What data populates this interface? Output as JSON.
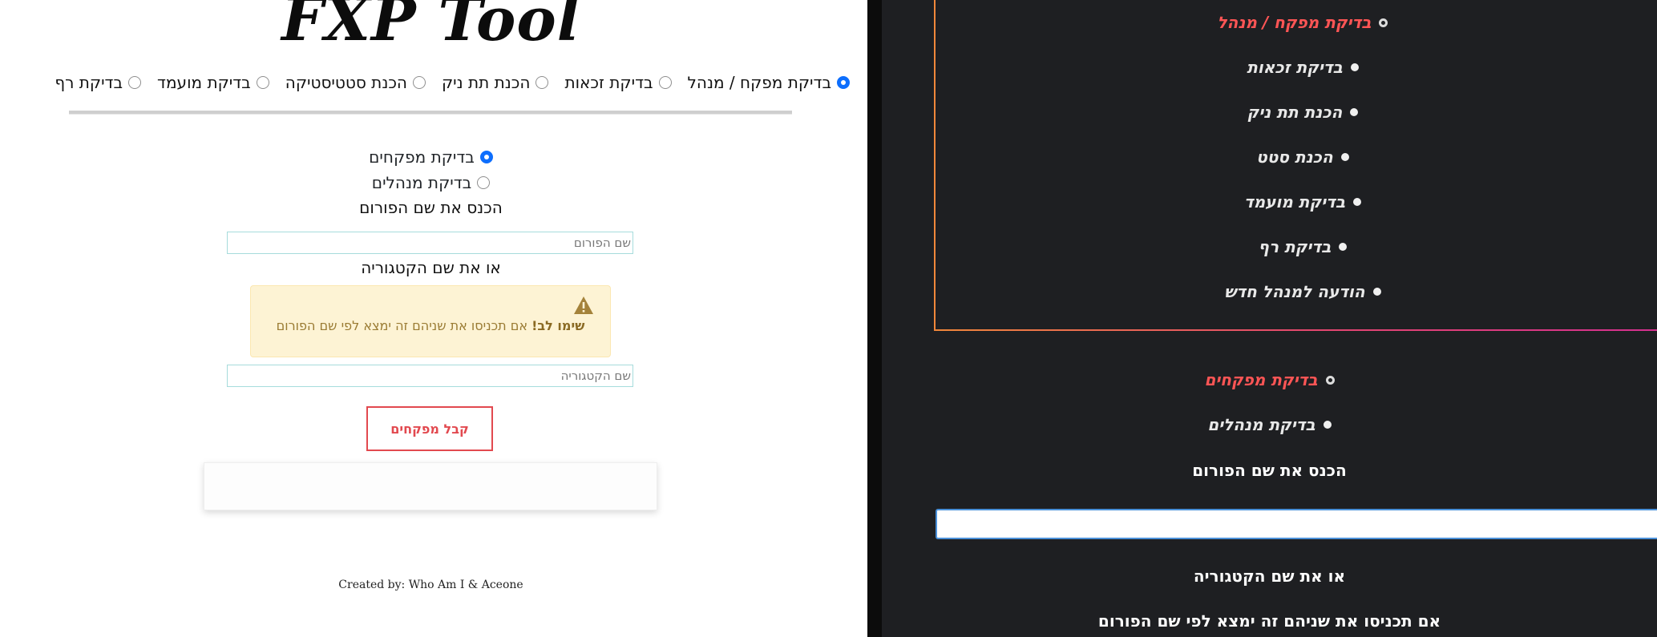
{
  "left": {
    "logo": "FXP Tool",
    "tool_options": [
      {
        "label": "בדיקת מפקח / מנהל",
        "selected": true
      },
      {
        "label": "בדיקת זכאות",
        "selected": false
      },
      {
        "label": "הכנת תת ניק",
        "selected": false
      },
      {
        "label": "הכנת סטטיסטיקה",
        "selected": false
      },
      {
        "label": "בדיקת מועמד",
        "selected": false
      },
      {
        "label": "בדיקת רף",
        "selected": false
      }
    ],
    "check_options": [
      {
        "label": "בדיקת מפקחים",
        "selected": true
      },
      {
        "label": "בדיקת מנהלים",
        "selected": false
      }
    ],
    "forum_label": "הכנס את שם הפורום",
    "forum_placeholder": "שם הפורום",
    "category_label": "או את שם הקטגוריה",
    "alert_bold": "שימו לב!",
    "alert_text": " אם תכניסו את שניהם זה ימצא לפי שם הפורום",
    "category_placeholder": "שם הקטגוריה",
    "submit_label": "קבל מפקחים",
    "credit": "Created by: Who Am I & Aceone"
  },
  "right": {
    "nav_items": [
      {
        "label": "בדיקת מפקח / מנהל",
        "active": true
      },
      {
        "label": "בדיקת זכאות",
        "active": false
      },
      {
        "label": "הכנת תת ניק",
        "active": false
      },
      {
        "label": "הכנת סטט",
        "active": false
      },
      {
        "label": "בדיקת מועמד",
        "active": false
      },
      {
        "label": "בדיקת רף",
        "active": false
      },
      {
        "label": "הודעה למנהל חדש",
        "active": false
      }
    ],
    "sub_items": [
      {
        "label": "בדיקת מפקחים",
        "active": true
      },
      {
        "label": "בדיקת מנהלים",
        "active": false
      }
    ],
    "forum_label": "הכנס את שם הפורום",
    "category_label": "או את שם הקטגוריה",
    "alert_text": "אם תכניסו את שניהם זה ימצא לפי שם הפורום"
  },
  "colors": {
    "accent_red": "#e2494f",
    "radio_blue": "#0d6efd",
    "dark_bg": "#1e1f22",
    "alert_bg": "#fdf3d4"
  }
}
